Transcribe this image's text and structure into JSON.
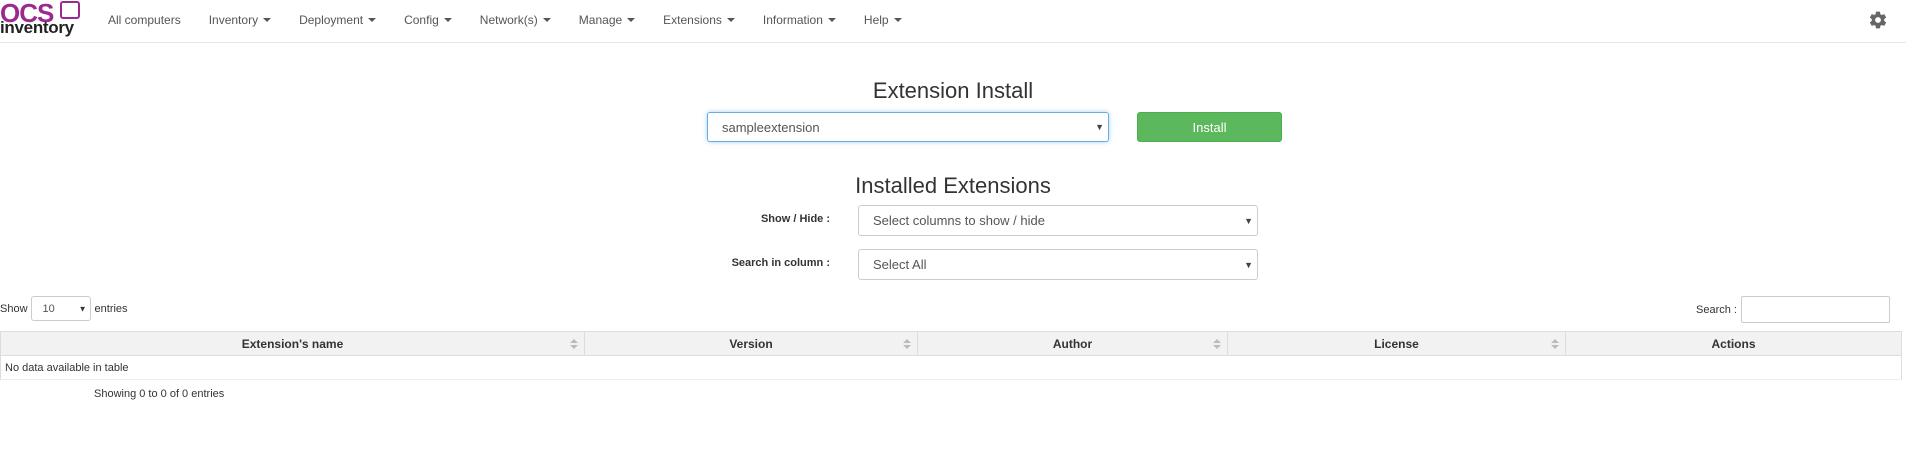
{
  "brand": {
    "logo_top": "OCS",
    "logo_bottom": "inventory",
    "color": "#9a2a8f"
  },
  "nav": {
    "items": [
      {
        "label": "All computers",
        "dropdown": false
      },
      {
        "label": "Inventory",
        "dropdown": true
      },
      {
        "label": "Deployment",
        "dropdown": true
      },
      {
        "label": "Config",
        "dropdown": true
      },
      {
        "label": "Network(s)",
        "dropdown": true
      },
      {
        "label": "Manage",
        "dropdown": true
      },
      {
        "label": "Extensions",
        "dropdown": true
      },
      {
        "label": "Information",
        "dropdown": true
      },
      {
        "label": "Help",
        "dropdown": true
      }
    ],
    "settings_icon": "gear-icon"
  },
  "install": {
    "title": "Extension Install",
    "selected": "sampleextension",
    "button_label": "Install",
    "button_color": "#5cb85c"
  },
  "installed": {
    "title": "Installed Extensions",
    "show_hide_label": "Show / Hide :",
    "show_hide_value": "Select columns to show / hide",
    "search_column_label": "Search in column :",
    "search_column_value": "Select All"
  },
  "table_controls": {
    "show_label": "Show",
    "page_length": "10",
    "entries_label": "entries",
    "search_label": "Search :",
    "search_value": ""
  },
  "table": {
    "columns": [
      {
        "label": "Extension's name",
        "sortable": true
      },
      {
        "label": "Version",
        "sortable": true
      },
      {
        "label": "Author",
        "sortable": true
      },
      {
        "label": "License",
        "sortable": true
      },
      {
        "label": "Actions",
        "sortable": false
      }
    ],
    "empty_message": "No data available in table",
    "info": "Showing 0 to 0 of 0 entries"
  }
}
